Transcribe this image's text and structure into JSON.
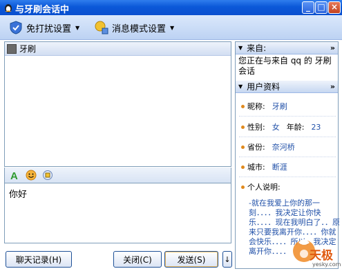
{
  "window": {
    "title": "与牙刷会话中",
    "minimize": "_",
    "maximize": "□",
    "close": "×"
  },
  "toolbar": {
    "dnd_label": "免打扰设置",
    "msg_mode_label": "消息模式设置"
  },
  "chat": {
    "contact_name": "牙刷",
    "input_text": "你好"
  },
  "buttons": {
    "history": "聊天记录(H)",
    "close": "关闭(C)",
    "send": "发送(S)",
    "send_option": "↓"
  },
  "from_section": {
    "title": "来自:",
    "text": "您正在与来自 qq 的 牙刷 会话"
  },
  "profile_section": {
    "title": "用户资料",
    "nickname_label": "昵称:",
    "nickname": "牙刷",
    "gender_label": "性别:",
    "gender": "女",
    "age_label": "年龄:",
    "age": "23",
    "province_label": "省份:",
    "province": "奈河桥",
    "city_label": "城市:",
    "city": "断涯",
    "sig_label": "个人说明:",
    "signature": "-就在我爱上你的那一刻．．．．我决定让你快乐．．．．现在我明白了．．原来只要我离开你．．．．你就会快乐．．．．所以，我决定离开你．．．．"
  },
  "watermark": {
    "brand": "天极",
    "site": "yesky.com"
  },
  "colors": {
    "titlebar": "#0b58d8",
    "accent_link": "#2050a8",
    "bullet": "#e08a1e"
  }
}
